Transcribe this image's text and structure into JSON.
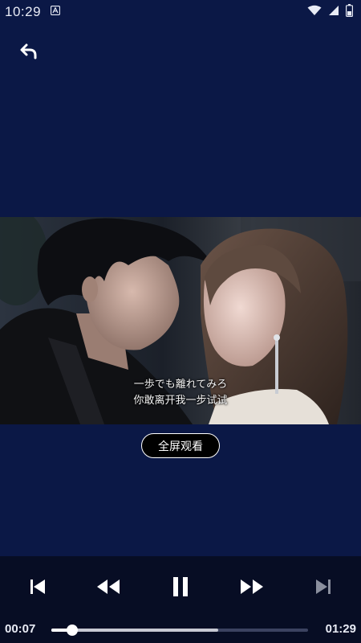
{
  "status_bar": {
    "time": "10:29",
    "icons": [
      "notification-a-icon",
      "wifi-icon",
      "signal-icon",
      "battery-icon"
    ]
  },
  "header": {
    "back_icon": "back-arrow-icon"
  },
  "video": {
    "subtitle_line1": "一歩でも離れてみろ",
    "subtitle_line2": "你敢离开我一步试试"
  },
  "fullscreen_button": {
    "label": "全屏观看"
  },
  "player": {
    "current_time": "00:07",
    "total_time": "01:29",
    "progress": 0.08,
    "buffered": 0.65,
    "controls": [
      "skip-previous-icon",
      "rewind-icon",
      "pause-icon",
      "fast-forward-icon",
      "skip-next-icon"
    ]
  },
  "colors": {
    "background": "#0b1846",
    "controls_background": "#070d24",
    "accent": "#ffffff"
  }
}
